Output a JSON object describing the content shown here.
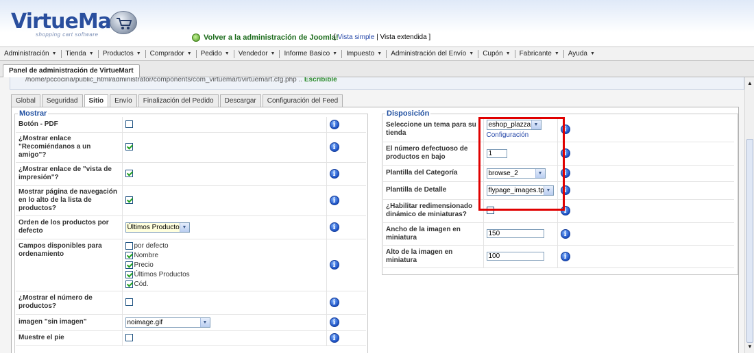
{
  "header": {
    "logo_text": "VirtueMart",
    "logo_sub": "shopping cart software",
    "joomla_link": "Volver a la administración de Joomla!",
    "view_open": "[ ",
    "view_simple": "Vista simple",
    "view_sep": " | ",
    "view_extended": "Vista extendida",
    "view_close": " ]"
  },
  "menu": [
    "Administración",
    "Tienda",
    "Productos",
    "Comprador",
    "Pedido",
    "Vendedor",
    "Informe Basico",
    "Impuesto",
    "Administración del Envío",
    "Cupón",
    "Fabricante",
    "Ayuda"
  ],
  "panel_tab": "Panel de administración de VirtueMart",
  "path_bar": {
    "path": "/home/pccocina/public_html/administrator/components/com_virtuemart/virtuemart.cfg.php .. ",
    "status": "Escribible"
  },
  "subtabs": [
    "Global",
    "Seguridad",
    "Sitio",
    "Envío",
    "Finalización del Pedido",
    "Descargar",
    "Configuración del Feed"
  ],
  "active_subtab": "Sitio",
  "mostrar": {
    "legend": "Mostrar",
    "rows": {
      "pdf": {
        "label": "Botón - PDF",
        "checked": false
      },
      "recommend": {
        "label": "¿Mostrar enlace \"Recomiéndanos a un amigo\"?",
        "checked": true
      },
      "print": {
        "label": "¿Mostrar enlace de \"vista de impresión\"?",
        "checked": true
      },
      "nav": {
        "label": "Mostrar página de navegación en lo alto de la lista de productos?",
        "checked": true
      },
      "order": {
        "label": "Orden de los productos por defecto",
        "value": "Últimos Productos"
      },
      "sort_fields": {
        "label": "Campos disponibles para ordenamiento",
        "options": [
          {
            "label": "por defecto",
            "checked": false
          },
          {
            "label": "Nombre",
            "checked": true
          },
          {
            "label": "Precio",
            "checked": true
          },
          {
            "label": "Últimos Productos",
            "checked": true
          },
          {
            "label": "Cód.",
            "checked": true
          }
        ]
      },
      "count": {
        "label": "¿Mostrar el número de productos?",
        "checked": false
      },
      "noimage": {
        "label": "imagen \"sin imagen\"",
        "value": "noimage.gif"
      },
      "footer": {
        "label": "Muestre el pie",
        "checked": false
      }
    }
  },
  "disposicion": {
    "legend": "Disposición",
    "rows": {
      "theme": {
        "label": "Seleccione un tema para su tienda",
        "value": "eshop_plazza",
        "link": "Configuración"
      },
      "per_page": {
        "label": "El número defectuoso de productos en bajo",
        "value": "1"
      },
      "cat_template": {
        "label": "Plantilla del Categoría",
        "value": "browse_2"
      },
      "detail_template": {
        "label": "Plantilla de Detalle",
        "value": "flypage_images.tpl"
      },
      "resize": {
        "label": "¿Habilitar redimensionado dinámico de miniaturas?",
        "checked": false
      },
      "thumb_width": {
        "label": "Ancho de la imagen en miniatura",
        "value": "150"
      },
      "thumb_height": {
        "label": "Alto de la imagen en miniatura",
        "value": "100"
      }
    }
  },
  "icons": {
    "info": "i",
    "dropdown": "▼",
    "scroll_up": "▲",
    "scroll_down": "▼"
  },
  "colors": {
    "highlight_border": "#e00000",
    "legend": "#1f4fa0",
    "link": "#2547a8",
    "ok": "#2a8a2a"
  }
}
